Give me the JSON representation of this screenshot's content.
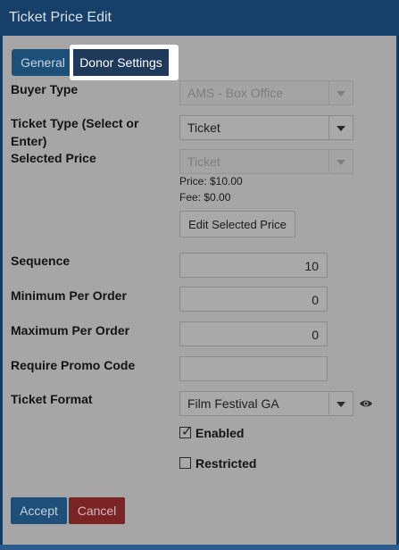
{
  "window": {
    "title": "Ticket Price Edit"
  },
  "tabs": [
    {
      "label": "General"
    },
    {
      "label": "Donor Settings"
    }
  ],
  "form": {
    "buyer_type": {
      "label": "Buyer Type",
      "value": "AMS - Box Office"
    },
    "ticket_type": {
      "label_line1": "Ticket Type (Select or",
      "label_line2": "Enter)",
      "value": "Ticket"
    },
    "selected_price": {
      "label": "Selected Price",
      "value": "Ticket",
      "price_text": "Price: $10.00",
      "fee_text": "Fee: $0.00",
      "edit_button": "Edit Selected Price"
    },
    "sequence": {
      "label": "Sequence",
      "value": "10"
    },
    "minimum_per_order": {
      "label": "Minimum Per Order",
      "value": "0"
    },
    "maximum_per_order": {
      "label": "Maximum Per Order",
      "value": "0"
    },
    "require_promo_code": {
      "label": "Require Promo Code",
      "value": ""
    },
    "ticket_format": {
      "label": "Ticket Format",
      "value": "Film Festival GA",
      "preview_icon": "eye-icon"
    },
    "enabled": {
      "label": "Enabled",
      "checked": true
    },
    "restricted": {
      "label": "Restricted",
      "checked": false
    }
  },
  "actions": {
    "accept_label": "Accept",
    "cancel_label": "Cancel"
  },
  "colors": {
    "title_bar": "#16406a",
    "panel": "#a6a6a6",
    "accept": "#1d4f78",
    "cancel": "#7b2426"
  }
}
